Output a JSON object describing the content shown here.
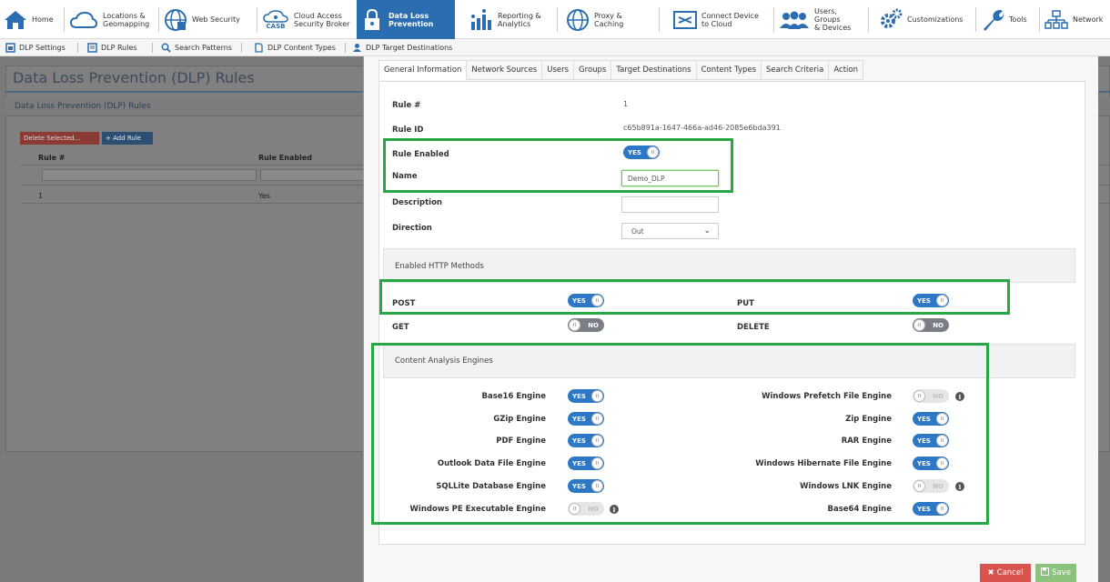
{
  "topnav": {
    "home": "Home",
    "locations": "Locations &\nGeomapping",
    "web_security": "Web Security",
    "casb": "Cloud Access\nSecurity Broker",
    "casb_icon_text": "CASB",
    "dlp": "Data Loss\nPrevention",
    "reporting": "Reporting &\nAnalytics",
    "proxy": "Proxy &\nCaching",
    "connect": "Connect Device\nto Cloud",
    "users": "Users, Groups\n& Devices",
    "customizations": "Customizations",
    "tools": "Tools",
    "network": "Network"
  },
  "subnav": {
    "settings": "DLP Settings",
    "rules": "DLP Rules",
    "patterns": "Search Patterns",
    "content_types": "DLP Content Types",
    "target_destinations": "DLP Target Destinations"
  },
  "background": {
    "title": "Data Loss Prevention (DLP) Rules",
    "subtitle": "Data Loss Prevention (DLP) Rules",
    "delete_btn": "Delete Selected...",
    "add_btn": "+ Add Rule",
    "col_rule": "Rule #",
    "col_enabled": "Rule Enabled",
    "row_rule": "1",
    "row_enabled": "Yes"
  },
  "tabs": [
    "General Information",
    "Network Sources",
    "Users",
    "Groups",
    "Target Destinations",
    "Content Types",
    "Search Criteria",
    "Action"
  ],
  "form": {
    "rule_num_label": "Rule #",
    "rule_num_value": "1",
    "rule_id_label": "Rule ID",
    "rule_id_value": "c65b891a-1647-466a-ad46-2085e6bda391",
    "rule_enabled_label": "Rule Enabled",
    "name_label": "Name",
    "name_value": "Demo_DLP",
    "description_label": "Description",
    "description_value": "",
    "direction_label": "Direction",
    "direction_value": "Out"
  },
  "toggle_text": {
    "yes": "YES",
    "no": "NO"
  },
  "http": {
    "title": "Enabled HTTP Methods",
    "post": "POST",
    "put": "PUT",
    "get": "GET",
    "delete": "DELETE"
  },
  "engines": {
    "title": "Content Analysis Engines",
    "base16": "Base16 Engine",
    "gzip": "GZip Engine",
    "pdf": "PDF Engine",
    "outlook": "Outlook Data File Engine",
    "sqllite": "SQLLite Database Engine",
    "winpe": "Windows PE Executable Engine",
    "prefetch": "Windows Prefetch File Engine",
    "zip": "Zip Engine",
    "rar": "RAR Engine",
    "hibernate": "Windows Hibernate File Engine",
    "lnk": "Windows LNK Engine",
    "base64": "Base64 Engine"
  },
  "footer": {
    "cancel": "Cancel",
    "save": "Save"
  },
  "colors": {
    "accent": "#2a6db0",
    "toggle_on": "#2d78c4",
    "highlight": "#28a745",
    "cancel": "#d9534f",
    "save": "#8dc27c"
  }
}
